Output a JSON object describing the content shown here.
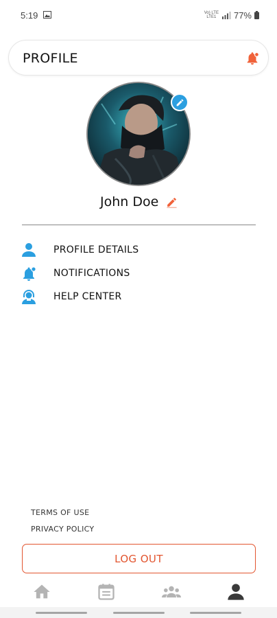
{
  "status_bar": {
    "time": "5:19",
    "network_label_top": "Vo) LTE",
    "network_label_bottom": "LTE1",
    "battery": "77%"
  },
  "header": {
    "title": "PROFILE",
    "bell_icon": "bell-icon",
    "accent_color": "#f0623a"
  },
  "profile": {
    "name": "John Doe",
    "avatar_edit_color": "#2b9fe0",
    "name_edit_color": "#f0623a"
  },
  "menu": {
    "items": [
      {
        "label": "PROFILE DETAILS",
        "icon": "person-icon"
      },
      {
        "label": "NOTIFICATIONS",
        "icon": "bell-icon"
      },
      {
        "label": "HELP CENTER",
        "icon": "support-agent-icon"
      }
    ],
    "icon_color": "#2b9fe0"
  },
  "footer": {
    "terms": "TERMS OF USE",
    "privacy": "PRIVACY POLICY"
  },
  "logout": {
    "label": "LOG OUT",
    "color": "#e2542e"
  },
  "bottom_nav": {
    "items": [
      {
        "icon": "home-icon",
        "active": false
      },
      {
        "icon": "calendar-icon",
        "active": false
      },
      {
        "icon": "groups-icon",
        "active": false
      },
      {
        "icon": "person-icon",
        "active": true
      }
    ]
  }
}
